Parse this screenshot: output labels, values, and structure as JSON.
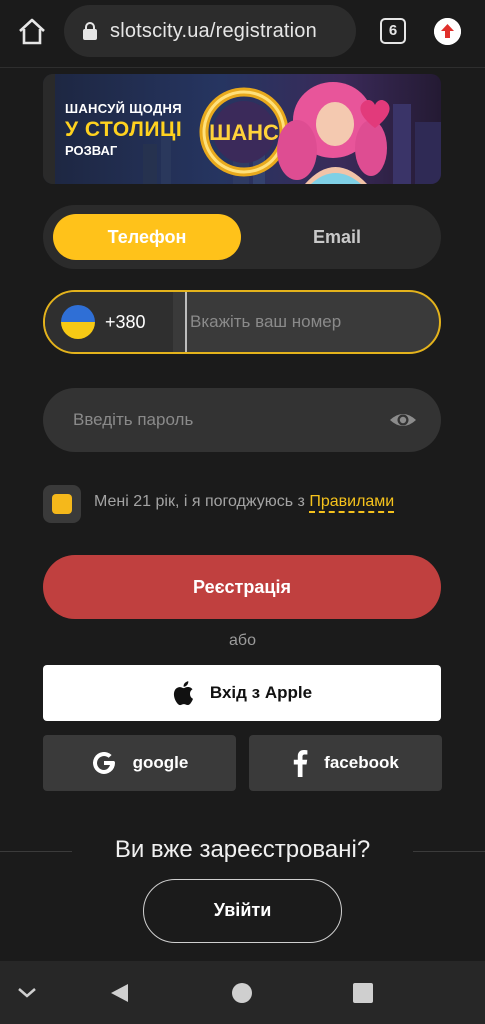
{
  "browser": {
    "url": "slotscity.ua/registration",
    "tab_count": "6"
  },
  "banner": {
    "line1": "ШАНСУЙ ЩОДНЯ",
    "line2": "У СТОЛИЦІ",
    "line3": "РОЗВАГ",
    "logo_text": "ШАНС"
  },
  "tabs": [
    {
      "label": "Телефон",
      "active": true
    },
    {
      "label": "Email",
      "active": false
    }
  ],
  "phone": {
    "country_code": "+380",
    "placeholder": "Вкажіть ваш номер",
    "value": ""
  },
  "password": {
    "placeholder": "Введіть пароль",
    "value": ""
  },
  "agreement": {
    "text": "Мені 21 рік, і я погоджуюсь з",
    "link": "Правилами"
  },
  "register_label": "Реєстрація",
  "or_label": "або",
  "apple_label": "Вхід з Apple",
  "google_label": "google",
  "facebook_label": "facebook",
  "already_label": "Ви вже зареєстровані?",
  "login_label": "Увійти",
  "colors": {
    "accent": "#ffc21a",
    "register": "#c0403f",
    "background": "#1b1b1b"
  }
}
